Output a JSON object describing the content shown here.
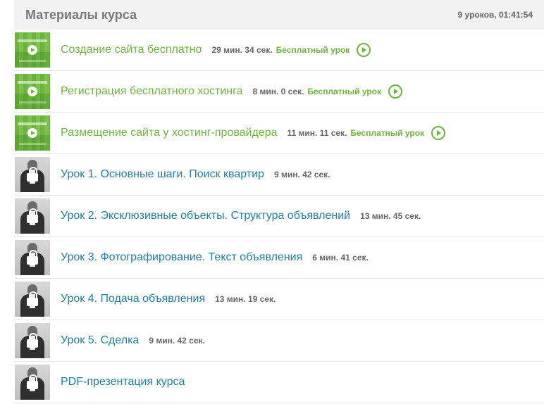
{
  "header": {
    "title": "Материалы курса",
    "meta": "9 уроков, 01:41:54"
  },
  "lessons": [
    {
      "title": "Создание сайта бесплатно",
      "duration": "29 мин. 34 сек.",
      "free_label": "Бесплатный урок"
    },
    {
      "title": "Регистрация бесплатного хостинга",
      "duration": "8 мин. 0 сек.",
      "free_label": "Бесплатный урок"
    },
    {
      "title": "Размещение сайта у хостинг-провайдера",
      "duration": "11 мин. 11 сек.",
      "free_label": "Бесплатный урок"
    },
    {
      "title": "Урок 1. Основные шаги. Поиск квартир",
      "duration": "9 мин. 42 сек."
    },
    {
      "title": "Урок 2. Эксклюзивные объекты. Структура объявлений",
      "duration": "13 мин. 45 сек."
    },
    {
      "title": "Урок 3. Фотографирование. Текст объявления",
      "duration": "6 мин. 41 сек."
    },
    {
      "title": "Урок 4. Подача объявления",
      "duration": "13 мин. 19 сек."
    },
    {
      "title": "Урок 5. Сделка",
      "duration": "9 мин. 42 сек."
    },
    {
      "title": "PDF-презентация курса"
    }
  ],
  "colors": {
    "free_accent": "#6db33f",
    "locked_link": "#1f7ea1",
    "header_bg": "#f2f2f2"
  },
  "icons": {
    "free_thumbnail_overlay": "play-icon",
    "free_action": "play-circle-icon",
    "locked_thumbnail_overlay": "lock-icon"
  }
}
